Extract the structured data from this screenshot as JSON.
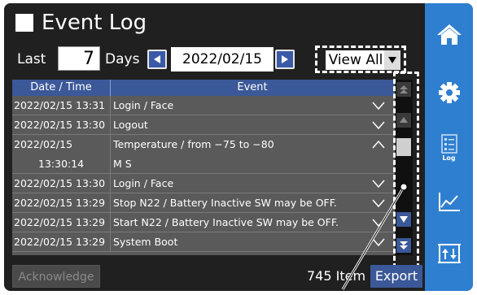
{
  "title": "Event Log",
  "controls": {
    "last_label": "Last",
    "days_value": "7",
    "days_label": "Days",
    "date": "2022/02/15",
    "view_filter": "View All"
  },
  "table": {
    "headers": [
      "Date / Time",
      "Event"
    ],
    "rows": [
      {
        "datetime": "2022/02/15 13:31",
        "event": "Login / Face",
        "expanded": false
      },
      {
        "datetime": "2022/02/15 13:30",
        "event": "Logout",
        "expanded": false
      },
      {
        "datetime": "2022/02/15",
        "event": "Temperature / from −75 to −80",
        "expanded": true
      },
      {
        "datetime": "13:30:14",
        "event": "M S",
        "expanded": null
      },
      {
        "datetime": "2022/02/15 13:30",
        "event": "Login / Face",
        "expanded": false
      },
      {
        "datetime": "2022/02/15 13:29",
        "event": "Stop N22 / Battery Inactive SW may be OFF.",
        "expanded": false
      },
      {
        "datetime": "2022/02/15 13:29",
        "event": "Start N22 / Battery Inactive SW may be OFF.",
        "expanded": false
      },
      {
        "datetime": "2022/02/15 13:29",
        "event": "System Boot",
        "expanded": false
      }
    ]
  },
  "footer": {
    "acknowledge_label": "Acknowledge",
    "items_count": "745 Item",
    "export_label": "Export"
  },
  "sidebar": {
    "items": [
      {
        "icon": "home-icon",
        "caption": ""
      },
      {
        "icon": "gear-icon",
        "caption": ""
      },
      {
        "icon": "log-icon",
        "caption": "Log"
      },
      {
        "icon": "graph-icon",
        "caption": ""
      },
      {
        "icon": "sort-icon",
        "caption": ""
      }
    ]
  },
  "colors": {
    "accent": "#3b5898",
    "sidebar": "#2f7fd0",
    "background": "#202020"
  }
}
